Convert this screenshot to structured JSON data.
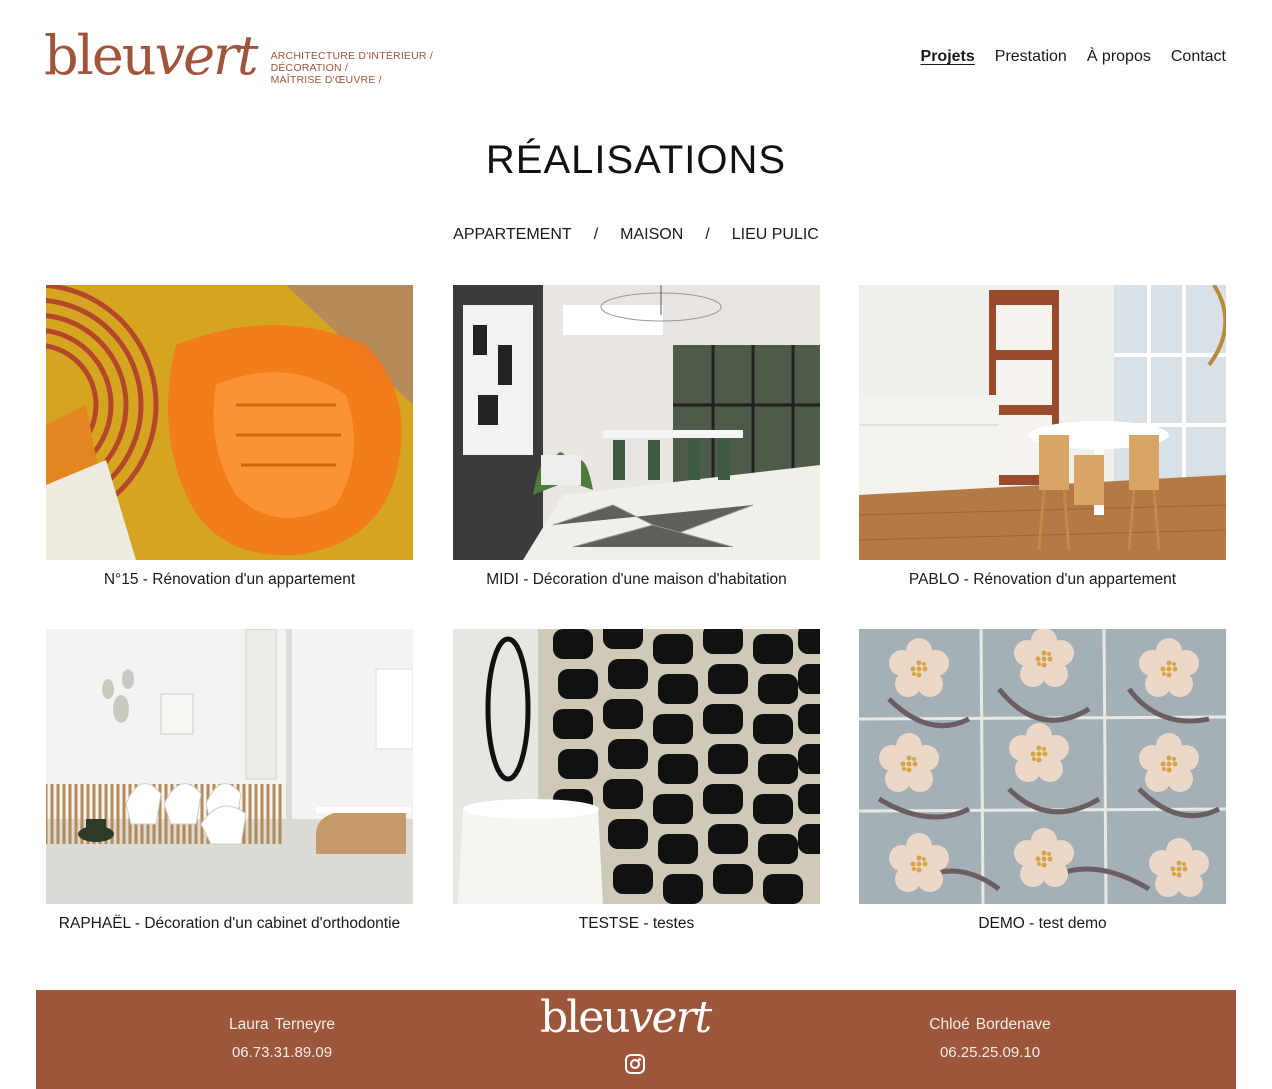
{
  "brand": {
    "logo_main": "bleu",
    "logo_accent": "vert",
    "tagline": [
      "ARCHITECTURE D'INTÉRIEUR /",
      "DÉCORATION /",
      "MAÎTRISE D'ŒUVRE /"
    ],
    "color": "#a0553a"
  },
  "nav": {
    "items": [
      {
        "label": "Projets",
        "active": true
      },
      {
        "label": "Prestation",
        "active": false
      },
      {
        "label": "À propos",
        "active": false
      },
      {
        "label": "Contact",
        "active": false
      }
    ]
  },
  "page": {
    "title": "RÉALISATIONS"
  },
  "filters": {
    "items": [
      "APPARTEMENT",
      "MAISON",
      "LIEU PULIC"
    ],
    "separator": "/"
  },
  "projects": [
    {
      "caption": "N°15 - Rénovation d'un appartement",
      "image": "orange-inflatable-chair-on-yellow-rug"
    },
    {
      "caption": "MIDI - Décoration d'une maison d'habitation",
      "image": "dining-room-with-pendant-lamp"
    },
    {
      "caption": "PABLO - Rénovation d'un appartement",
      "image": "kitchen-with-round-table-and-chairs"
    },
    {
      "caption": "RAPHAËL - Décoration d'un cabinet d'orthodontie",
      "image": "waiting-room-with-white-chairs"
    },
    {
      "caption": "TESTSE - testes",
      "image": "black-white-patterned-wallpaper-with-lamp"
    },
    {
      "caption": "DEMO - test demo",
      "image": "floral-tiles"
    }
  ],
  "footer": {
    "background": "#9c563b",
    "logo_main": "bleu",
    "logo_accent": "vert",
    "contact_left": {
      "first": "Laura",
      "last": "Terneyre",
      "phone": "06.73.31.89.09"
    },
    "contact_right": {
      "first": "Chloé",
      "last": "Bordenave",
      "phone": "06.25.25.09.10"
    },
    "social_icon": "instagram-icon"
  }
}
